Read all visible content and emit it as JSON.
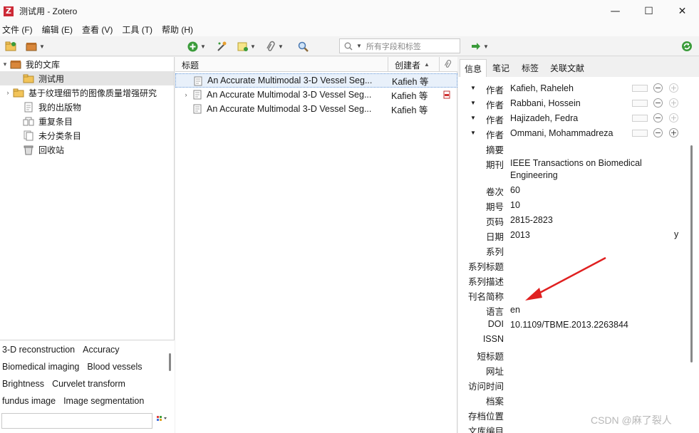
{
  "window": {
    "app_icon_letter": "Z",
    "title": "测试用 - Zotero",
    "buttons": [
      "—",
      "☐",
      "✕"
    ]
  },
  "menu": [
    "文件 (F)",
    "编辑 (E)",
    "查看 (V)",
    "工具 (T)",
    "帮助 (H)"
  ],
  "toolbar": {
    "search_placeholder": "所有字段和标签",
    "colors": {
      "green": "#3a9b3a",
      "orange": "#e8a030"
    }
  },
  "collections": [
    {
      "label": "我的文库",
      "icon": "library-icon",
      "twisty": "▾"
    },
    {
      "label": "测试用",
      "icon": "folder-icon",
      "twisty": "",
      "selected": true
    },
    {
      "label": "基于纹理细节的图像质量增强研究",
      "icon": "folder-icon",
      "twisty": "›"
    },
    {
      "label": "我的出版物",
      "icon": "publications-icon",
      "twisty": ""
    },
    {
      "label": "重复条目",
      "icon": "duplicates-icon",
      "twisty": ""
    },
    {
      "label": "未分类条目",
      "icon": "unfiled-icon",
      "twisty": ""
    },
    {
      "label": "回收站",
      "icon": "trash-icon",
      "twisty": ""
    }
  ],
  "tags": [
    [
      "3-D reconstruction",
      "Accuracy"
    ],
    [
      "Biomedical imaging",
      "Blood vessels"
    ],
    [
      "Brightness",
      "Curvelet transform"
    ],
    [
      "fundus image",
      "Image segmentation"
    ]
  ],
  "items_header": {
    "title": "标题",
    "creator": "创建者",
    "sort_arrow": "▲"
  },
  "items": [
    {
      "title": "An Accurate Multimodal 3-D Vessel Seg...",
      "creator": "Kafieh 等",
      "twisty": "",
      "selected": true,
      "pdf": false
    },
    {
      "title": "An Accurate Multimodal 3-D Vessel Seg...",
      "creator": "Kafieh 等",
      "twisty": "›",
      "selected": false,
      "pdf": true
    },
    {
      "title": "An Accurate Multimodal 3-D Vessel Seg...",
      "creator": "Kafieh 等",
      "twisty": "",
      "selected": false,
      "pdf": false
    }
  ],
  "tabs": [
    "信息",
    "笔记",
    "标签",
    "关联文献"
  ],
  "creators": [
    {
      "label": "作者",
      "name": "Kafieh, Raheleh"
    },
    {
      "label": "作者",
      "name": "Rabbani, Hossein"
    },
    {
      "label": "作者",
      "name": "Hajizadeh, Fedra"
    },
    {
      "label": "作者",
      "name": "Ommani, Mohammadreza"
    }
  ],
  "fields": [
    {
      "label": "摘要",
      "value": ""
    },
    {
      "label": "期刊",
      "value": "IEEE Transactions on Biomedical Engineering",
      "lines": 2
    },
    {
      "label": "卷次",
      "value": "60"
    },
    {
      "label": "期号",
      "value": "10"
    },
    {
      "label": "页码",
      "value": "2815-2823"
    },
    {
      "label": "日期",
      "value": "2013",
      "suffix": "y"
    },
    {
      "label": "系列",
      "value": ""
    },
    {
      "label": "系列标题",
      "value": ""
    },
    {
      "label": "系列描述",
      "value": ""
    },
    {
      "label": "刊名简称",
      "value": ""
    },
    {
      "label": "语言",
      "value": "en"
    },
    {
      "label": "DOI",
      "value": "10.1109/TBME.2013.2263844"
    },
    {
      "label": "ISSN",
      "value": ""
    },
    {
      "label": "短标题",
      "value": ""
    },
    {
      "label": "网址",
      "value": ""
    },
    {
      "label": "访问时间",
      "value": ""
    },
    {
      "label": "档案",
      "value": ""
    },
    {
      "label": "存档位置",
      "value": ""
    },
    {
      "label": "文库编目",
      "value": ""
    }
  ],
  "watermark": "CSDN @麻了裂人",
  "annotation_color": "#e02020"
}
